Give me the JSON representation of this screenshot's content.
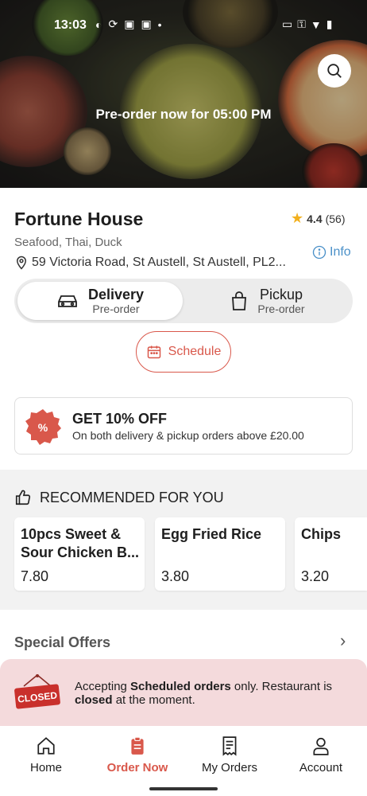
{
  "status_bar": {
    "time": "13:03"
  },
  "hero": {
    "preorder_text": "Pre-order now for 05:00 PM"
  },
  "restaurant": {
    "name": "Fortune House",
    "rating": "4.4",
    "rating_count": "(56)",
    "cuisine": "Seafood, Thai, Duck",
    "address": "59 Victoria Road, St Austell, St Austell, PL2...",
    "info_label": "Info"
  },
  "mode_toggle": {
    "delivery": {
      "title": "Delivery",
      "sub": "Pre-order"
    },
    "pickup": {
      "title": "Pickup",
      "sub": "Pre-order"
    }
  },
  "schedule_label": "Schedule",
  "offer": {
    "title": "GET 10% OFF",
    "subtitle": "On both delivery & pickup orders above £20.00"
  },
  "recommended": {
    "heading": "RECOMMENDED FOR YOU",
    "items": [
      {
        "name": "10pcs Sweet & Sour Chicken B...",
        "price": "7.80"
      },
      {
        "name": "Egg Fried Rice",
        "price": "3.80"
      },
      {
        "name": "Chips",
        "price": "3.20"
      }
    ]
  },
  "special_offers_label": "Special Offers",
  "closed_banner": {
    "sign_text": "CLOSED",
    "text_1": "Accepting ",
    "text_bold_1": "Scheduled orders",
    "text_2": " only. Restaurant is ",
    "text_bold_2": "closed",
    "text_3": " at the moment."
  },
  "bottom_nav": [
    {
      "label": "Home",
      "icon": "home-icon"
    },
    {
      "label": "Order Now",
      "icon": "order-icon"
    },
    {
      "label": "My Orders",
      "icon": "receipt-icon"
    },
    {
      "label": "Account",
      "icon": "account-icon"
    }
  ],
  "colors": {
    "accent": "#d9584b",
    "link": "#4a90c8",
    "star": "#f2b01e",
    "banner_bg": "#f4dadc"
  }
}
